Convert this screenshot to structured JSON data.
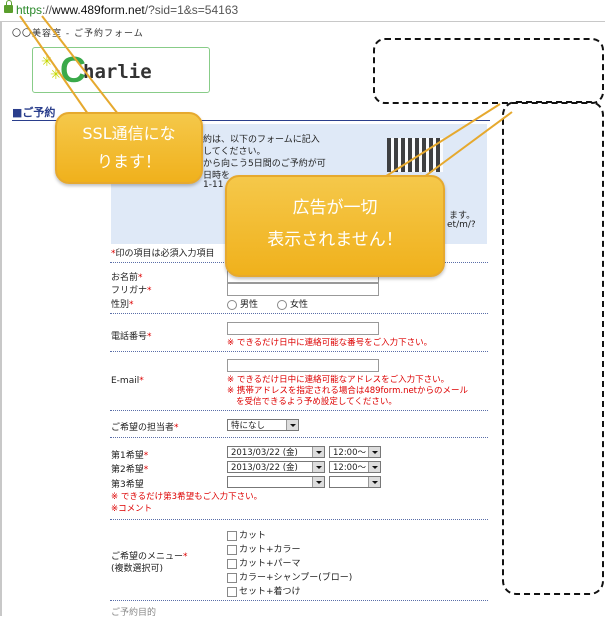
{
  "browser": {
    "url_scheme": "https",
    "url_sep": "://",
    "url_host": "www.489form.net",
    "url_path": "/?sid=1&s=54163"
  },
  "site": {
    "title": "〇〇美容室 - ご予約フォーム",
    "logo_text": "harlie",
    "logo_letter": "C",
    "section_title": "■ご予約"
  },
  "notice": {
    "lines": [
      "約は、以下のフォームに記入",
      "してください。",
      "から向こう5日間のご予約が可",
      "日時を",
      "1-11",
      "ます。",
      "et/m/?"
    ]
  },
  "form": {
    "required_note_mark": "*",
    "required_note": "印の項目は必須入力項目",
    "required_mark": "*",
    "name_label": "お名前",
    "furigana_label": "フリガナ",
    "gender_label": "性別",
    "gender_options": [
      "男性",
      "女性"
    ],
    "phone_label": "電話番号",
    "phone_help": "※ できるだけ日中に連絡可能な番号をご入力下さい。",
    "email_label": "E-mail",
    "email_help": [
      "※ できるだけ日中に連絡可能なアドレスをご入力下さい。",
      "※ 携帯アドレスを指定される場合は489form.netからのメール",
      "を受信できるよう予め設定してください。"
    ],
    "staff_label": "ご希望の担当者",
    "staff_value": "特になし",
    "wish1_label": "第1希望",
    "wish2_label": "第2希望",
    "wish3_label": "第3希望",
    "wish1_date": "2013/03/22 (金)",
    "wish1_time": "12:00〜",
    "wish2_date": "2013/03/22 (金)",
    "wish2_time": "12:00〜",
    "wish3_help": "※ できるだけ第3希望もご入力下さい。",
    "comment_label": "※コメント",
    "menu_label": "ご希望のメニュー",
    "menu_sub": "(複数選択可)",
    "menu_options": [
      "カット",
      "カット+カラー",
      "カット+パーマ",
      "カラー+シャンプー(ブロー)",
      "セット+着つけ"
    ],
    "cut_row_label": "ご予約目的"
  },
  "callouts": {
    "ssl_line1": "SSL通信にな",
    "ssl_line2": "ります！",
    "ads_line1": "広告が一切",
    "ads_line2": "表示されません！"
  },
  "colors": {
    "callout_fill": "#f0b11c",
    "url_https": "#2c8a2c",
    "section_blue": "#2a3e8c",
    "notice_bg": "#dfe9f7",
    "required_red": "#dd0000"
  }
}
